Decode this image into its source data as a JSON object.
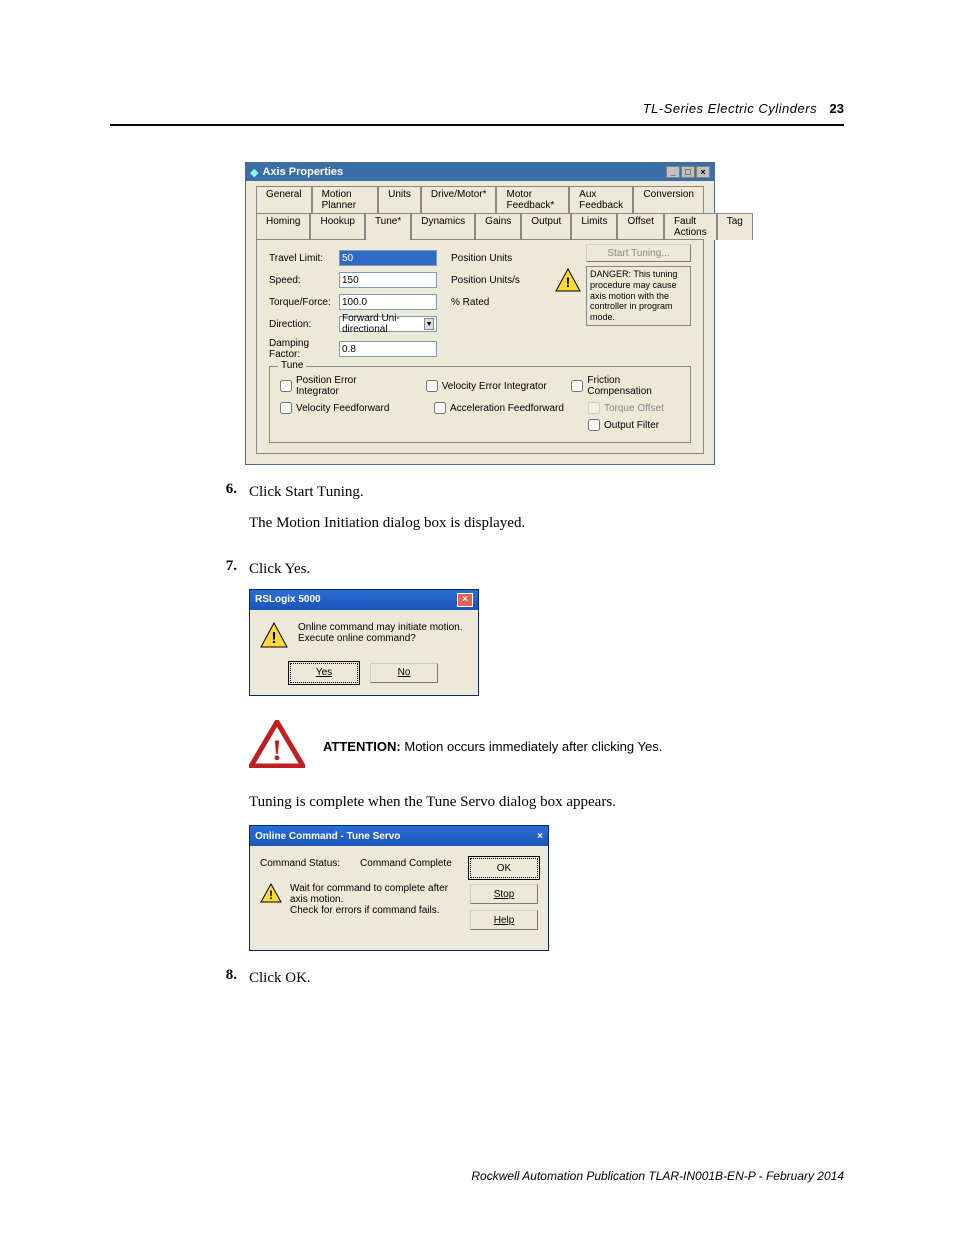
{
  "header": {
    "title": "TL-Series Electric Cylinders",
    "page": "23"
  },
  "axis": {
    "title": "Axis Properties",
    "tabs_row1": [
      "General",
      "Motion Planner",
      "Units",
      "Drive/Motor*",
      "Motor Feedback*",
      "Aux Feedback",
      "Conversion"
    ],
    "tabs_row2": [
      "Homing",
      "Hookup",
      "Tune*",
      "Dynamics",
      "Gains",
      "Output",
      "Limits",
      "Offset",
      "Fault Actions",
      "Tag"
    ],
    "fields": {
      "travel_limit": {
        "label": "Travel Limit:",
        "value": "50",
        "unit": "Position Units"
      },
      "speed": {
        "label": "Speed:",
        "value": "150",
        "unit": "Position Units/s"
      },
      "torque": {
        "label": "Torque/Force:",
        "value": "100.0",
        "unit": "% Rated"
      },
      "direction": {
        "label": "Direction:",
        "value": "Forward Uni-directional"
      },
      "damping": {
        "label": "Damping Factor:",
        "value": "0.8"
      }
    },
    "start_tuning": "Start Tuning...",
    "danger": "DANGER: This tuning procedure may cause axis motion with the controller in program mode.",
    "tune_legend": "Tune",
    "checks": {
      "pei": "Position Error Integrator",
      "vei": "Velocity Error Integrator",
      "fc": "Friction Compensation",
      "vff": "Velocity Feedforward",
      "aff": "Acceleration Feedforward",
      "to": "Torque Offset",
      "of": "Output Filter"
    }
  },
  "steps": {
    "s6": {
      "num": "6.",
      "title": "Click Start Tuning.",
      "body": "The Motion Initiation dialog box is displayed."
    },
    "s7": {
      "num": "7.",
      "title": "Click Yes."
    },
    "s8": {
      "num": "8.",
      "title": "Click OK."
    }
  },
  "rslogix": {
    "title": "RSLogix 5000",
    "msg1": "Online command may initiate motion.",
    "msg2": "Execute online command?",
    "yes": "Yes",
    "no": "No"
  },
  "attention": {
    "label": "ATTENTION:",
    "text": " Motion occurs immediately after clicking Yes."
  },
  "tune_complete": "Tuning is complete when the Tune Servo dialog box appears.",
  "tuneservo": {
    "title": "Online Command - Tune Servo",
    "status_label": "Command Status:",
    "status_value": "Command Complete",
    "note1": "Wait for command to complete after axis motion.",
    "note2": "Check for errors if command fails.",
    "ok": "OK",
    "stop": "Stop",
    "help": "Help"
  },
  "footer": "Rockwell Automation Publication TLAR-IN001B-EN-P - February 2014"
}
